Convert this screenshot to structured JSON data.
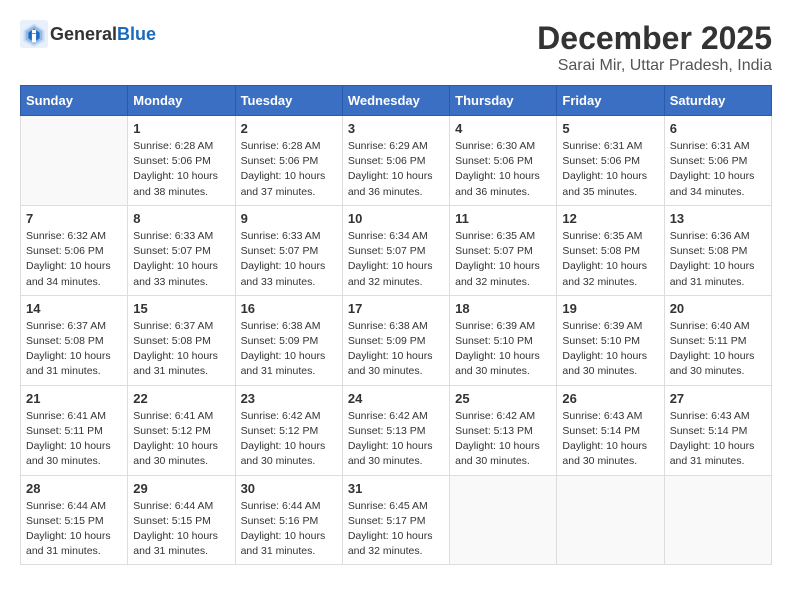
{
  "header": {
    "logo_general": "General",
    "logo_blue": "Blue",
    "month": "December 2025",
    "location": "Sarai Mir, Uttar Pradesh, India"
  },
  "weekdays": [
    "Sunday",
    "Monday",
    "Tuesday",
    "Wednesday",
    "Thursday",
    "Friday",
    "Saturday"
  ],
  "weeks": [
    [
      {
        "day": "",
        "info": ""
      },
      {
        "day": "1",
        "info": "Sunrise: 6:28 AM\nSunset: 5:06 PM\nDaylight: 10 hours\nand 38 minutes."
      },
      {
        "day": "2",
        "info": "Sunrise: 6:28 AM\nSunset: 5:06 PM\nDaylight: 10 hours\nand 37 minutes."
      },
      {
        "day": "3",
        "info": "Sunrise: 6:29 AM\nSunset: 5:06 PM\nDaylight: 10 hours\nand 36 minutes."
      },
      {
        "day": "4",
        "info": "Sunrise: 6:30 AM\nSunset: 5:06 PM\nDaylight: 10 hours\nand 36 minutes."
      },
      {
        "day": "5",
        "info": "Sunrise: 6:31 AM\nSunset: 5:06 PM\nDaylight: 10 hours\nand 35 minutes."
      },
      {
        "day": "6",
        "info": "Sunrise: 6:31 AM\nSunset: 5:06 PM\nDaylight: 10 hours\nand 34 minutes."
      }
    ],
    [
      {
        "day": "7",
        "info": "Sunrise: 6:32 AM\nSunset: 5:06 PM\nDaylight: 10 hours\nand 34 minutes."
      },
      {
        "day": "8",
        "info": "Sunrise: 6:33 AM\nSunset: 5:07 PM\nDaylight: 10 hours\nand 33 minutes."
      },
      {
        "day": "9",
        "info": "Sunrise: 6:33 AM\nSunset: 5:07 PM\nDaylight: 10 hours\nand 33 minutes."
      },
      {
        "day": "10",
        "info": "Sunrise: 6:34 AM\nSunset: 5:07 PM\nDaylight: 10 hours\nand 32 minutes."
      },
      {
        "day": "11",
        "info": "Sunrise: 6:35 AM\nSunset: 5:07 PM\nDaylight: 10 hours\nand 32 minutes."
      },
      {
        "day": "12",
        "info": "Sunrise: 6:35 AM\nSunset: 5:08 PM\nDaylight: 10 hours\nand 32 minutes."
      },
      {
        "day": "13",
        "info": "Sunrise: 6:36 AM\nSunset: 5:08 PM\nDaylight: 10 hours\nand 31 minutes."
      }
    ],
    [
      {
        "day": "14",
        "info": "Sunrise: 6:37 AM\nSunset: 5:08 PM\nDaylight: 10 hours\nand 31 minutes."
      },
      {
        "day": "15",
        "info": "Sunrise: 6:37 AM\nSunset: 5:08 PM\nDaylight: 10 hours\nand 31 minutes."
      },
      {
        "day": "16",
        "info": "Sunrise: 6:38 AM\nSunset: 5:09 PM\nDaylight: 10 hours\nand 31 minutes."
      },
      {
        "day": "17",
        "info": "Sunrise: 6:38 AM\nSunset: 5:09 PM\nDaylight: 10 hours\nand 30 minutes."
      },
      {
        "day": "18",
        "info": "Sunrise: 6:39 AM\nSunset: 5:10 PM\nDaylight: 10 hours\nand 30 minutes."
      },
      {
        "day": "19",
        "info": "Sunrise: 6:39 AM\nSunset: 5:10 PM\nDaylight: 10 hours\nand 30 minutes."
      },
      {
        "day": "20",
        "info": "Sunrise: 6:40 AM\nSunset: 5:11 PM\nDaylight: 10 hours\nand 30 minutes."
      }
    ],
    [
      {
        "day": "21",
        "info": "Sunrise: 6:41 AM\nSunset: 5:11 PM\nDaylight: 10 hours\nand 30 minutes."
      },
      {
        "day": "22",
        "info": "Sunrise: 6:41 AM\nSunset: 5:12 PM\nDaylight: 10 hours\nand 30 minutes."
      },
      {
        "day": "23",
        "info": "Sunrise: 6:42 AM\nSunset: 5:12 PM\nDaylight: 10 hours\nand 30 minutes."
      },
      {
        "day": "24",
        "info": "Sunrise: 6:42 AM\nSunset: 5:13 PM\nDaylight: 10 hours\nand 30 minutes."
      },
      {
        "day": "25",
        "info": "Sunrise: 6:42 AM\nSunset: 5:13 PM\nDaylight: 10 hours\nand 30 minutes."
      },
      {
        "day": "26",
        "info": "Sunrise: 6:43 AM\nSunset: 5:14 PM\nDaylight: 10 hours\nand 30 minutes."
      },
      {
        "day": "27",
        "info": "Sunrise: 6:43 AM\nSunset: 5:14 PM\nDaylight: 10 hours\nand 31 minutes."
      }
    ],
    [
      {
        "day": "28",
        "info": "Sunrise: 6:44 AM\nSunset: 5:15 PM\nDaylight: 10 hours\nand 31 minutes."
      },
      {
        "day": "29",
        "info": "Sunrise: 6:44 AM\nSunset: 5:15 PM\nDaylight: 10 hours\nand 31 minutes."
      },
      {
        "day": "30",
        "info": "Sunrise: 6:44 AM\nSunset: 5:16 PM\nDaylight: 10 hours\nand 31 minutes."
      },
      {
        "day": "31",
        "info": "Sunrise: 6:45 AM\nSunset: 5:17 PM\nDaylight: 10 hours\nand 32 minutes."
      },
      {
        "day": "",
        "info": ""
      },
      {
        "day": "",
        "info": ""
      },
      {
        "day": "",
        "info": ""
      }
    ]
  ]
}
